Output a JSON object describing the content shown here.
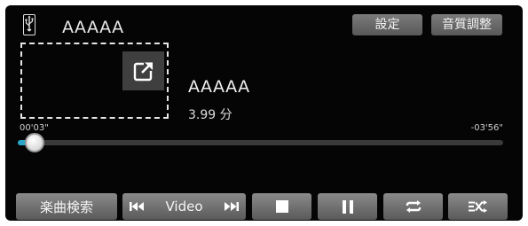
{
  "header": {
    "source_icon": "usb-icon",
    "source_title": "AAAAA",
    "settings_label": "設定",
    "audio_label": "音質調整"
  },
  "now_playing": {
    "art_link_icon": "open-external-icon",
    "title": "AAAAA",
    "length": "3.99 分"
  },
  "progress": {
    "elapsed": "00'03\"",
    "remaining": "-03'56\"",
    "fraction": 0.035
  },
  "controls": {
    "search_label": "楽曲検索",
    "video_label": "Video",
    "prev_icon": "previous-track-icon",
    "next_icon": "next-track-icon",
    "stop_icon": "stop-icon",
    "pause_icon": "pause-icon",
    "repeat_icon": "repeat-icon",
    "shuffle_icon": "shuffle-icon"
  },
  "colors": {
    "background": "#050505",
    "accent": "#2aa6c9",
    "button": "#6e6e6e"
  }
}
